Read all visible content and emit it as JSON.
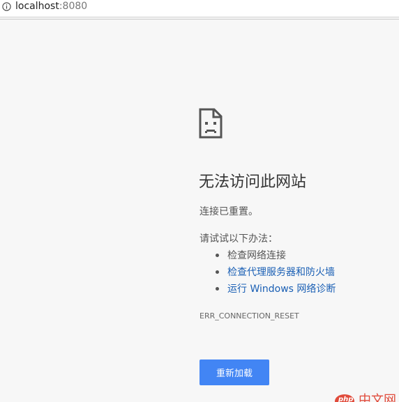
{
  "browser": {
    "url_host": "localhost",
    "url_port": ":8080",
    "info_icon": "info-icon"
  },
  "error_page": {
    "icon": "sad-page-icon",
    "title": "无法访问此网站",
    "subtitle": "连接已重置。",
    "suggestions_heading": "请试试以下办法：",
    "suggestions": [
      {
        "label": "检查网络连接",
        "link": false
      },
      {
        "label": "检查代理服务器和防火墙",
        "link": true
      },
      {
        "label": "运行 Windows 网络诊断",
        "link": true
      }
    ],
    "error_code": "ERR_CONNECTION_RESET",
    "reload_button": "重新加载"
  },
  "watermark": {
    "logo_text": "php",
    "text": "中文网"
  },
  "colors": {
    "background": "#f7f7f7",
    "button": "#4285f4",
    "link": "#1a5fb4",
    "watermark": "#e04a3a"
  }
}
